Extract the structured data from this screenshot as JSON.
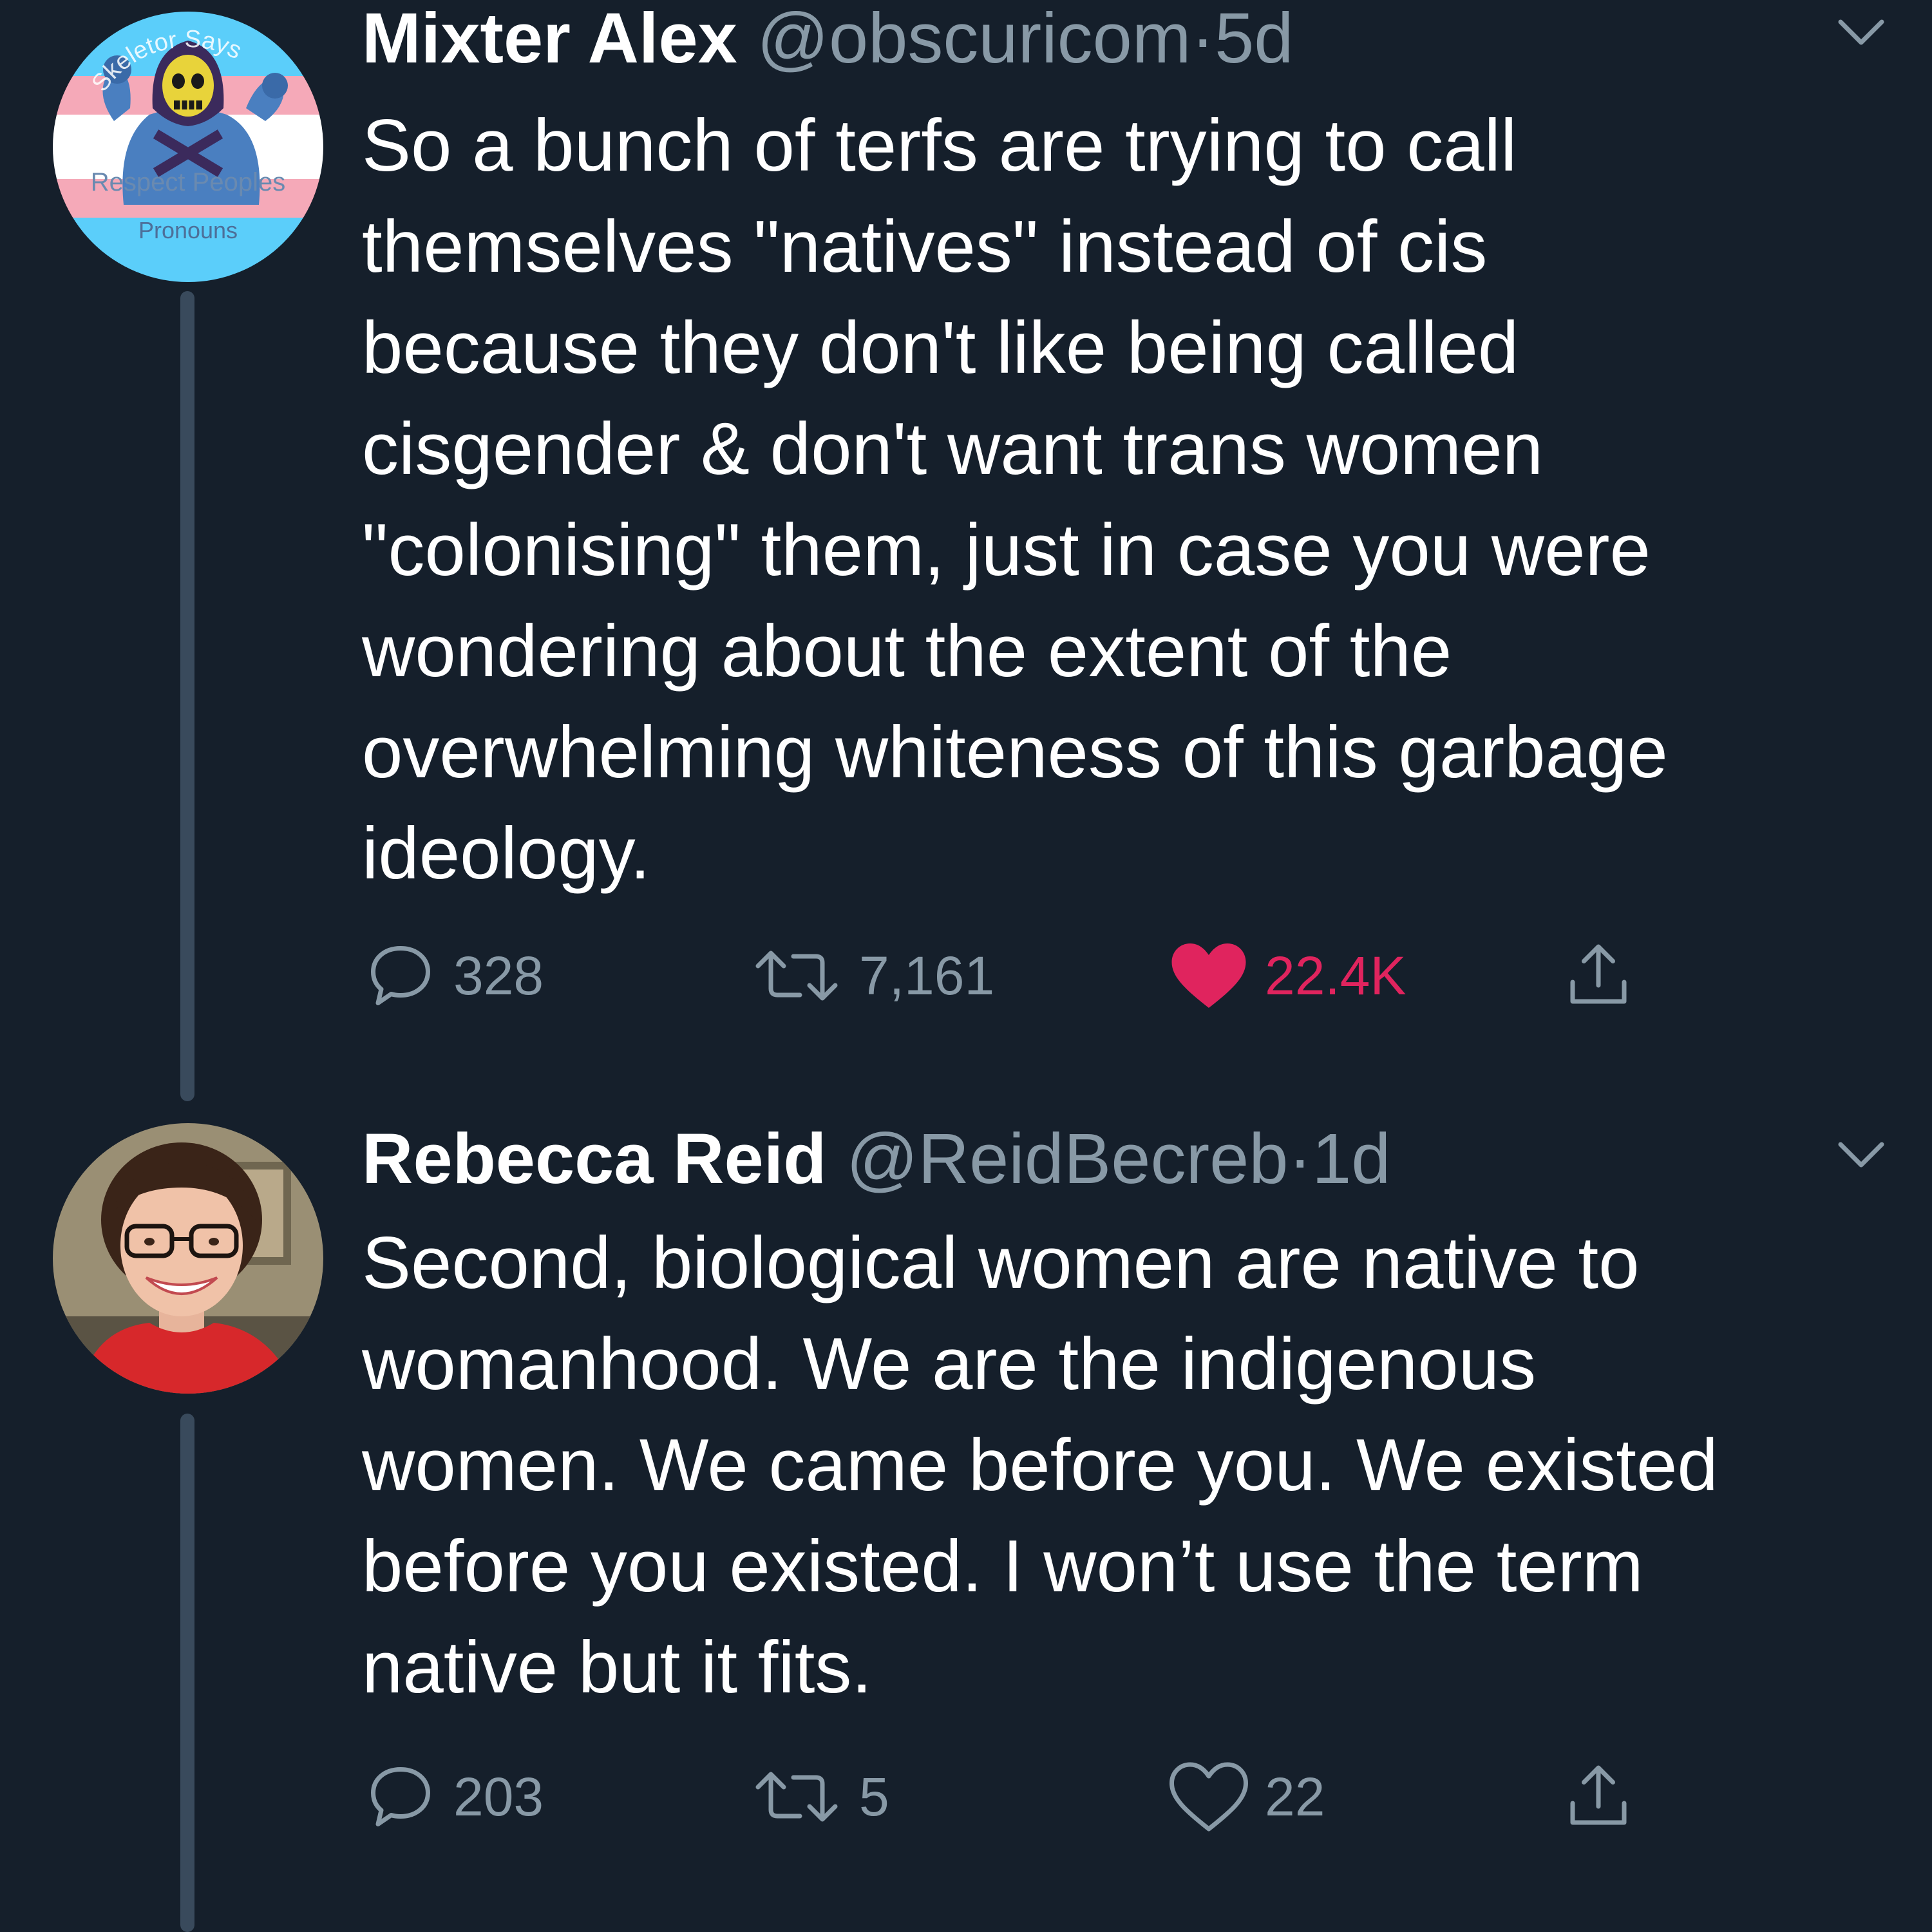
{
  "colors": {
    "background": "#151f2b",
    "text": "#ffffff",
    "secondary": "#8899a6",
    "thread_line": "#394a5c",
    "like_active": "#e0245e"
  },
  "tweets": [
    {
      "author_name": "Mixter Alex",
      "handle": "@obscuricom",
      "separator": "·",
      "time": "5d",
      "avatar": {
        "icon": "skeletor-avatar",
        "text_top": "Skeletor Says",
        "text_middle": "Respect Peoples",
        "text_bottom": "Pronouns"
      },
      "text": "So a bunch of terfs are trying to call\nthemselves \"natives\" instead of cis\nbecause they don't like being called\ncisgender & don't want trans women\n\"colonising\" them, just in case you were\nwondering about the extent of the\noverwhelming whiteness of this garbage\nideology.",
      "replies": "328",
      "retweets": "7,161",
      "likes": "22.4K",
      "liked": true
    },
    {
      "author_name": "Rebecca Reid",
      "handle": "@ReidBecreb",
      "separator": "·",
      "time": "1d",
      "avatar": {
        "icon": "profile-photo"
      },
      "text": "Second, biological women are native to\nwomanhood. We are the indigenous\nwomen. We came before you. We existed\nbefore you existed. I won’t use the term\nnative but it fits.",
      "replies": "203",
      "retweets": "5",
      "likes": "22",
      "liked": false
    }
  ]
}
